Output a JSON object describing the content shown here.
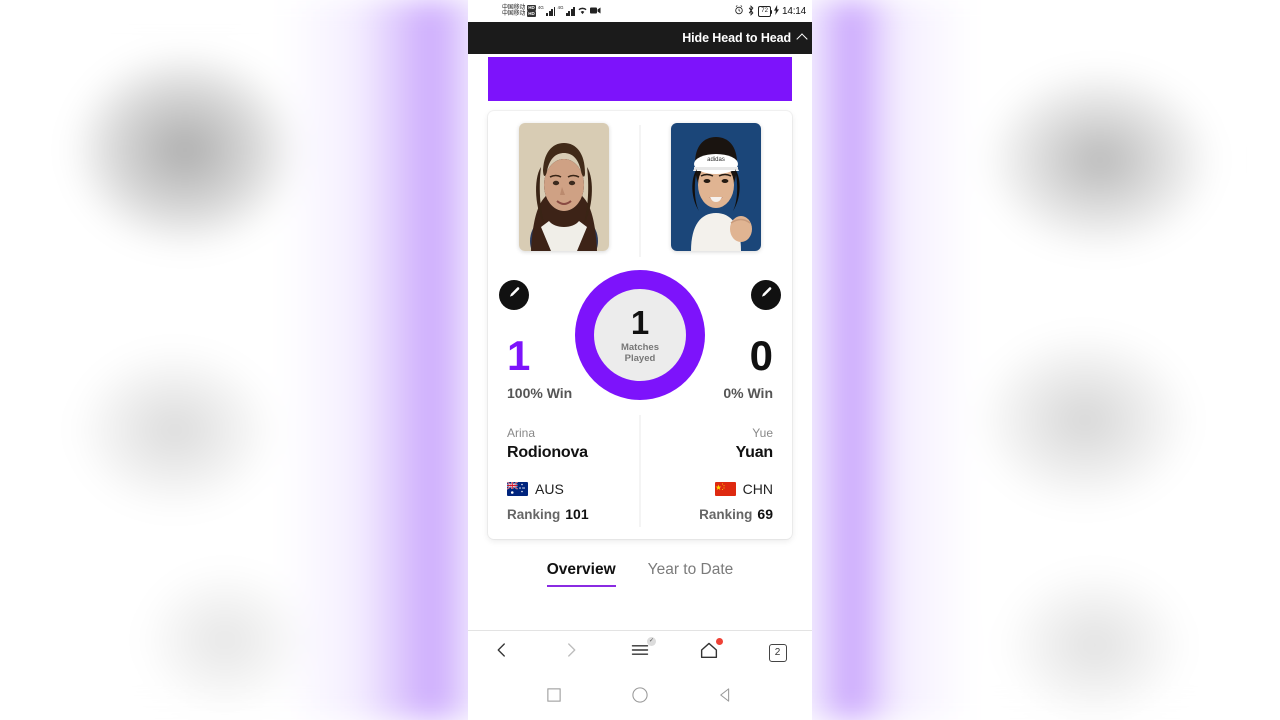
{
  "status_bar": {
    "carrier_1": "中国移动",
    "carrier_2": "中国移动",
    "hd_badge": "HD",
    "net_1": "4G",
    "net_2": "4G",
    "battery_percent": "72",
    "time": "14:14",
    "icons": [
      "alarm-icon",
      "bluetooth-icon",
      "battery-icon",
      "charging-icon",
      "signal-icon",
      "wifi-icon",
      "video-call-icon"
    ]
  },
  "header": {
    "label": "Hide Head to Head",
    "chevron": "chevron-up-icon",
    "background": "#1b1b1b"
  },
  "banner": {
    "color": "#7d13fb"
  },
  "matchup": {
    "accent": "#7d13fb",
    "center": {
      "value": "1",
      "label_line1": "Matches",
      "label_line2": "Played"
    },
    "left": {
      "wins": "1",
      "win_pct": "100% Win",
      "first_name": "Arina",
      "last_name": "Rodionova",
      "country_code": "AUS",
      "ranking_label": "Ranking",
      "ranking_value": "101",
      "edit_icon": "pencil-icon",
      "photo": "player-photo-rodionova"
    },
    "right": {
      "wins": "0",
      "win_pct": "0% Win",
      "first_name": "Yue",
      "last_name": "Yuan",
      "country_code": "CHN",
      "ranking_label": "Ranking",
      "ranking_value": "69",
      "edit_icon": "pencil-icon",
      "photo": "player-photo-yuan"
    }
  },
  "tabs": [
    {
      "label": "Overview",
      "active": true
    },
    {
      "label": "Year to Date",
      "active": false
    }
  ],
  "browser_nav": {
    "back": "back-arrow-icon",
    "forward": "forward-arrow-icon",
    "menu": "hamburger-menu-icon",
    "home": "home-icon",
    "tab_count": "2"
  },
  "android_nav": {
    "recents": "square-icon",
    "home": "circle-icon",
    "back": "triangle-back-icon"
  }
}
